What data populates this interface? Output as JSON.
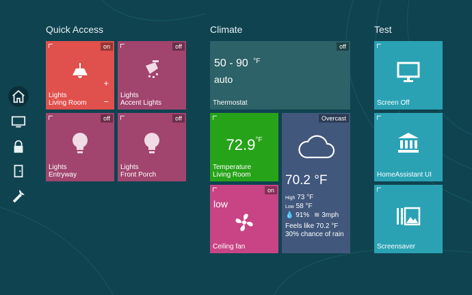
{
  "sidebar": {
    "items": [
      {
        "name": "home-icon",
        "active": true
      },
      {
        "name": "screen-icon",
        "active": false
      },
      {
        "name": "lock-icon",
        "active": false
      },
      {
        "name": "door-icon",
        "active": false
      },
      {
        "name": "wrench-icon",
        "active": false
      }
    ]
  },
  "groups": {
    "quick_access": {
      "title": "Quick Access"
    },
    "climate": {
      "title": "Climate"
    },
    "test": {
      "title": "Test"
    }
  },
  "tiles": {
    "living_room_lights": {
      "state": "on",
      "line1": "Lights",
      "line2": "Living Room",
      "plus": "+",
      "minus": "−",
      "color": "#e0504c"
    },
    "accent_lights": {
      "state": "off",
      "line1": "Lights",
      "line2": "Accent Lights",
      "color": "#a1456e"
    },
    "entryway": {
      "state": "off",
      "line1": "Lights",
      "line2": "Entryway",
      "color": "#a1456e"
    },
    "front_porch": {
      "state": "off",
      "line1": "Lights",
      "line2": "Front Porch",
      "color": "#a1456e"
    },
    "thermostat": {
      "state": "off",
      "range": "50 - 90",
      "unit": "°F",
      "mode": "auto",
      "label": "Thermostat",
      "color": "#2c6268"
    },
    "temperature": {
      "value": "72.9",
      "unit": "°F",
      "line1": "Temperature",
      "line2": "Living Room",
      "color": "#27a31a"
    },
    "weather": {
      "condition": "Overcast",
      "temp": "70.2 °F",
      "high_label": "High",
      "high": "73 °F",
      "low_label": "Low",
      "low": "58 °F",
      "humidity": "91%",
      "wind": "3mph",
      "feels_like": "Feels like 70.2 °F",
      "rain": "30% chance of rain",
      "color": "#41577c"
    },
    "ceiling_fan": {
      "state": "on",
      "speed": "low",
      "label": "Ceiling fan",
      "color": "#c84484"
    },
    "screen_off": {
      "label": "Screen Off",
      "color": "#2aa2b4"
    },
    "homeassistant_ui": {
      "label": "HomeAssistant UI",
      "color": "#2aa2b4"
    },
    "screensaver": {
      "label": "Screensaver",
      "color": "#2aa2b4"
    }
  }
}
